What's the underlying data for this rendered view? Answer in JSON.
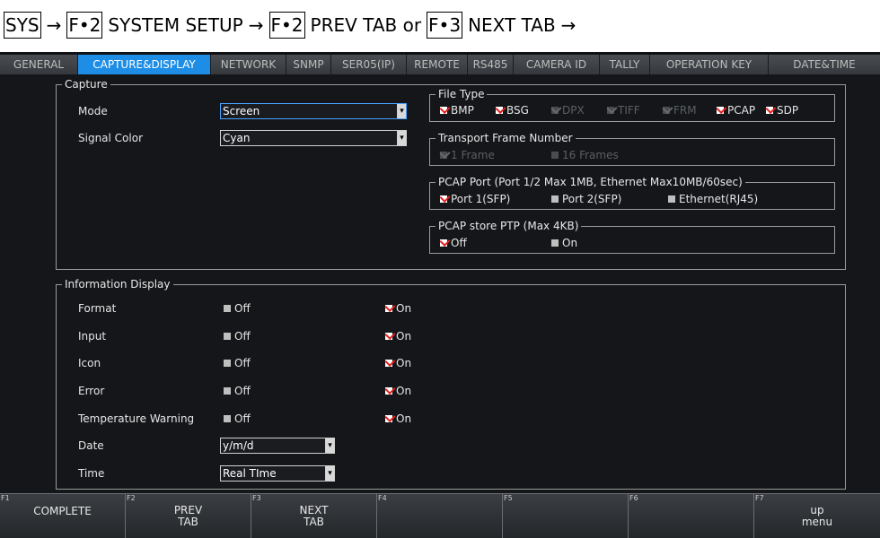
{
  "breadcrumb": {
    "sys": "SYS",
    "arrow": "→",
    "f2": "F•2",
    "system_setup": "SYSTEM SETUP",
    "prev_tab": "PREV TAB or",
    "f3": "F•3",
    "next_tab": "NEXT TAB"
  },
  "tabs": [
    {
      "label": "GENERAL"
    },
    {
      "label": "CAPTURE&DISPLAY",
      "active": true
    },
    {
      "label": "NETWORK"
    },
    {
      "label": "SNMP"
    },
    {
      "label": "SER05(IP)"
    },
    {
      "label": "REMOTE"
    },
    {
      "label": "RS485"
    },
    {
      "label": "CAMERA ID"
    },
    {
      "label": "TALLY"
    },
    {
      "label": "OPERATION KEY"
    },
    {
      "label": "DATE&TIME"
    }
  ],
  "capture": {
    "legend": "Capture",
    "mode_label": "Mode",
    "mode_value": "Screen",
    "signal_color_label": "Signal Color",
    "signal_color_value": "Cyan"
  },
  "file_type": {
    "legend": "File Type",
    "options": [
      {
        "label": "BMP",
        "checked": true,
        "enabled": true
      },
      {
        "label": "BSG",
        "checked": true,
        "enabled": true
      },
      {
        "label": "DPX",
        "checked": true,
        "enabled": false
      },
      {
        "label": "TIFF",
        "checked": true,
        "enabled": false
      },
      {
        "label": "FRM",
        "checked": true,
        "enabled": false
      },
      {
        "label": "PCAP",
        "checked": true,
        "enabled": true
      },
      {
        "label": "SDP",
        "checked": true,
        "enabled": true
      }
    ]
  },
  "transport_frame": {
    "legend": "Transport Frame Number",
    "options": [
      {
        "label": "1 Frame",
        "checked": true,
        "enabled": false
      },
      {
        "label": "16 Frames",
        "checked": false,
        "enabled": false
      }
    ]
  },
  "pcap_port": {
    "legend": "PCAP Port (Port 1/2 Max 1MB, Ethernet Max10MB/60sec)",
    "options": [
      {
        "label": "Port 1(SFP)",
        "checked": true,
        "enabled": true
      },
      {
        "label": "Port 2(SFP)",
        "checked": false,
        "enabled": true
      },
      {
        "label": "Ethernet(RJ45)",
        "checked": false,
        "enabled": true
      }
    ]
  },
  "pcap_ptp": {
    "legend": "PCAP store PTP (Max 4KB)",
    "options": [
      {
        "label": "Off",
        "checked": true,
        "enabled": true
      },
      {
        "label": "On",
        "checked": false,
        "enabled": true
      }
    ]
  },
  "info_display": {
    "legend": "Information Display",
    "off_label": "Off",
    "on_label": "On",
    "rows": [
      {
        "label": "Format",
        "value": "On"
      },
      {
        "label": "Input",
        "value": "On"
      },
      {
        "label": "Icon",
        "value": "On"
      },
      {
        "label": "Error",
        "value": "On"
      },
      {
        "label": "Temperature Warning",
        "value": "On"
      }
    ],
    "date_label": "Date",
    "date_value": "y/m/d",
    "time_label": "Time",
    "time_value": "Real TIme"
  },
  "fkeys": [
    {
      "num": "F1",
      "label": "COMPLETE"
    },
    {
      "num": "F2",
      "label": "PREV\nTAB"
    },
    {
      "num": "F3",
      "label": "NEXT\nTAB"
    },
    {
      "num": "F4",
      "label": ""
    },
    {
      "num": "F5",
      "label": ""
    },
    {
      "num": "F6",
      "label": ""
    },
    {
      "num": "F7",
      "label": "up\nmenu"
    }
  ],
  "colors": {
    "active_tab": "#1d8de6",
    "check_mark": "#e02020",
    "focus_border": "#4aa3ff"
  }
}
